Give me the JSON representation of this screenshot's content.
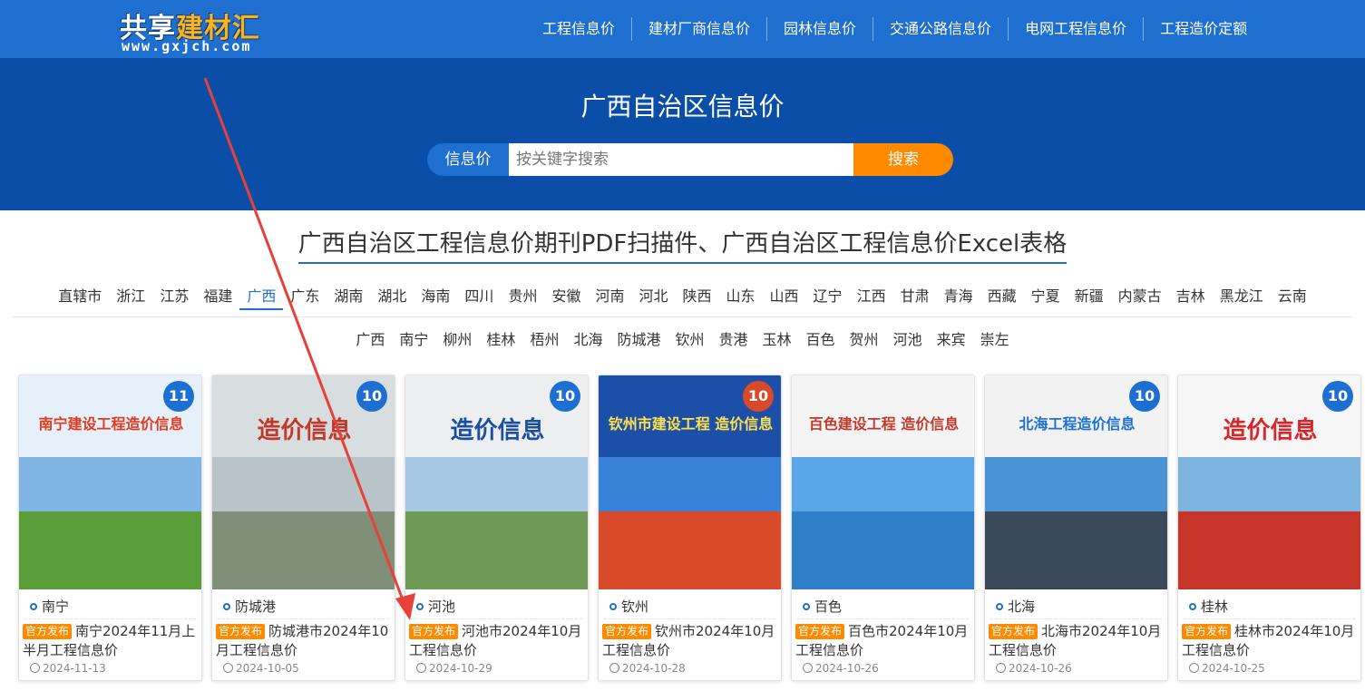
{
  "logo": {
    "part1": "共享",
    "part2": "建材汇",
    "url": "www.gxjch.com"
  },
  "nav": [
    "工程信息价",
    "建材厂商信息价",
    "园林信息价",
    "交通公路信息价",
    "电网工程信息价",
    "工程造价定额"
  ],
  "hero": {
    "title": "广西自治区信息价",
    "search_type": "信息价",
    "search_placeholder": "按关键字搜索",
    "search_button": "搜索"
  },
  "section_title": "广西自治区工程信息价期刊PDF扫描件、广西自治区工程信息价Excel表格",
  "provinces": [
    "直辖市",
    "浙江",
    "江苏",
    "福建",
    "广西",
    "广东",
    "湖南",
    "湖北",
    "海南",
    "四川",
    "贵州",
    "安徽",
    "河南",
    "河北",
    "陕西",
    "山东",
    "山西",
    "辽宁",
    "江西",
    "甘肃",
    "青海",
    "西藏",
    "宁夏",
    "新疆",
    "内蒙古",
    "吉林",
    "黑龙江",
    "云南"
  ],
  "active_province": "广西",
  "cities": [
    "广西",
    "南宁",
    "柳州",
    "桂林",
    "梧州",
    "北海",
    "防城港",
    "钦州",
    "贵港",
    "玉林",
    "百色",
    "贺州",
    "河池",
    "来宾",
    "崇左"
  ],
  "cards": [
    {
      "city": "南宁",
      "badge": "官方发布",
      "title": "南宁2024年11月上半月工程信息价",
      "date": "2024-11-13",
      "cover_title": "南宁建设工程造价信息",
      "cover_num": "11",
      "top_color": "#e6f0fa",
      "mid_color": "#7fb6e6",
      "bot_color": "#5a9e3a",
      "tag_color": "#e03a1e"
    },
    {
      "city": "防城港",
      "badge": "官方发布",
      "title": "防城港市2024年10月工程信息价",
      "date": "2024-10-05",
      "cover_title": "造价信息",
      "cover_num": "10",
      "top_color": "#d8dde0",
      "mid_color": "#b9c4c8",
      "bot_color": "#7f8f78",
      "tag_color": "#c0392b"
    },
    {
      "city": "河池",
      "badge": "官方发布",
      "title": "河池市2024年10月工程信息价",
      "date": "2024-10-29",
      "cover_title": "造价信息",
      "cover_num": "10",
      "top_color": "#eceef0",
      "mid_color": "#a7c8e4",
      "bot_color": "#6f9a56",
      "tag_color": "#1d4fa0"
    },
    {
      "city": "钦州",
      "badge": "官方发布",
      "title": "钦州市2024年10月工程信息价",
      "date": "2024-10-28",
      "cover_title": "钦州市建设工程 造价信息",
      "cover_num": "10",
      "top_color": "#1c4fa8",
      "mid_color": "#3a82d8",
      "bot_color": "#d94a2a",
      "tag_color": "#ffe14d"
    },
    {
      "city": "百色",
      "badge": "官方发布",
      "title": "百色市2024年10月工程信息价",
      "date": "2024-10-26",
      "cover_title": "百色建设工程 造价信息",
      "cover_num": "",
      "top_color": "#f4f4f4",
      "mid_color": "#5aa6e8",
      "bot_color": "#2f7fc8",
      "tag_color": "#c0392b"
    },
    {
      "city": "北海",
      "badge": "官方发布",
      "title": "北海市2024年10月工程信息价",
      "date": "2024-10-26",
      "cover_title": "北海工程造价信息",
      "cover_num": "10",
      "top_color": "#f2f2f2",
      "mid_color": "#4a94d6",
      "bot_color": "#3b4a5a",
      "tag_color": "#1d6fd1"
    },
    {
      "city": "桂林",
      "badge": "官方发布",
      "title": "桂林市2024年10月工程信息价",
      "date": "2024-10-25",
      "cover_title": "造价信息",
      "cover_num": "10",
      "top_color": "#f6f6f6",
      "mid_color": "#7db4e0",
      "bot_color": "#c7342a",
      "tag_color": "#d6282b"
    }
  ]
}
